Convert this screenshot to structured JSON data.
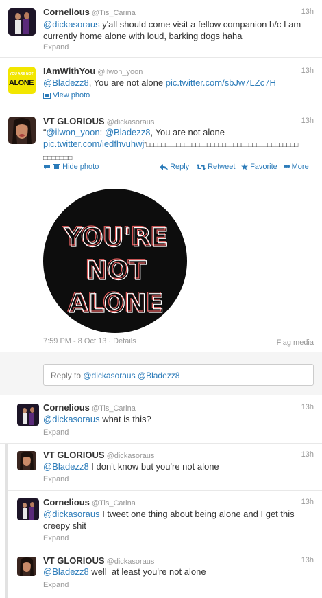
{
  "colors": {
    "link": "#2b7bb9",
    "muted": "#999999",
    "text": "#333333"
  },
  "tweets": [
    {
      "name": "Cornelious",
      "handle": "@Tis_Carina",
      "time": "13h",
      "line1_mention": "@dickasoraus",
      "line1_rest": " y'all should come visit a fellow companion b/c I am",
      "line2": "currently home alone with loud, barking dogs haha",
      "expand": "Expand"
    },
    {
      "name": "IAmWithYou",
      "handle": "@ilwon_yoon",
      "time": "13h",
      "mention": "@Bladezz8",
      "text": ", You are not alone ",
      "link": "pic.twitter.com/sbJw7LZc7H",
      "view_photo": "View photo",
      "avatar_text_top": "YOU ARE NOT",
      "avatar_text_bottom": "ALONE"
    },
    {
      "name": "VT GLORIOUS",
      "handle": "@dickasoraus",
      "time": "13h",
      "quote_open": "“",
      "quote_mention1": "@ilwon_yoon",
      "quote_colon": ": ",
      "quote_mention2": "@Bladezz8",
      "quote_text": ", You are not alone",
      "line2_link": "pic.twitter.com/iedfhvuhwj",
      "line2_rest": "”□□□□□□□□□□□□□□□□□□□□□□□□□□□□□□□□□□□□□□□□",
      "line3": "□□□□□□□",
      "hide_photo": "Hide photo",
      "reply": "Reply",
      "retweet": "Retweet",
      "favorite": "Favorite",
      "more": "More",
      "media_lines": [
        "YOU'RE",
        "NOT",
        "ALONE"
      ],
      "timestamp": "7:59 PM - 8 Oct 13",
      "details": "Details",
      "flag_media": "Flag media",
      "reply_prefix": "Reply to ",
      "reply_mentions": "@dickasoraus @Bladezz8"
    }
  ],
  "conversation": [
    {
      "name": "Cornelious",
      "handle": "@Tis_Carina",
      "time": "13h",
      "mention": "@dickasoraus",
      "text": " what is this?",
      "expand": "Expand"
    },
    {
      "name": "VT GLORIOUS",
      "handle": "@dickasoraus",
      "time": "13h",
      "mention": "@Bladezz8",
      "text": " I don't know but you're not alone",
      "expand": "Expand"
    },
    {
      "name": "Cornelious",
      "handle": "@Tis_Carina",
      "time": "13h",
      "mention": "@dickasoraus",
      "text": " I tweet one thing about being alone and I get this",
      "line2": "creepy shit",
      "expand": "Expand"
    },
    {
      "name": "VT GLORIOUS",
      "handle": "@dickasoraus",
      "time": "13h",
      "mention": "@Bladezz8",
      "text": " well  at least you're not alone",
      "expand": "Expand"
    }
  ]
}
